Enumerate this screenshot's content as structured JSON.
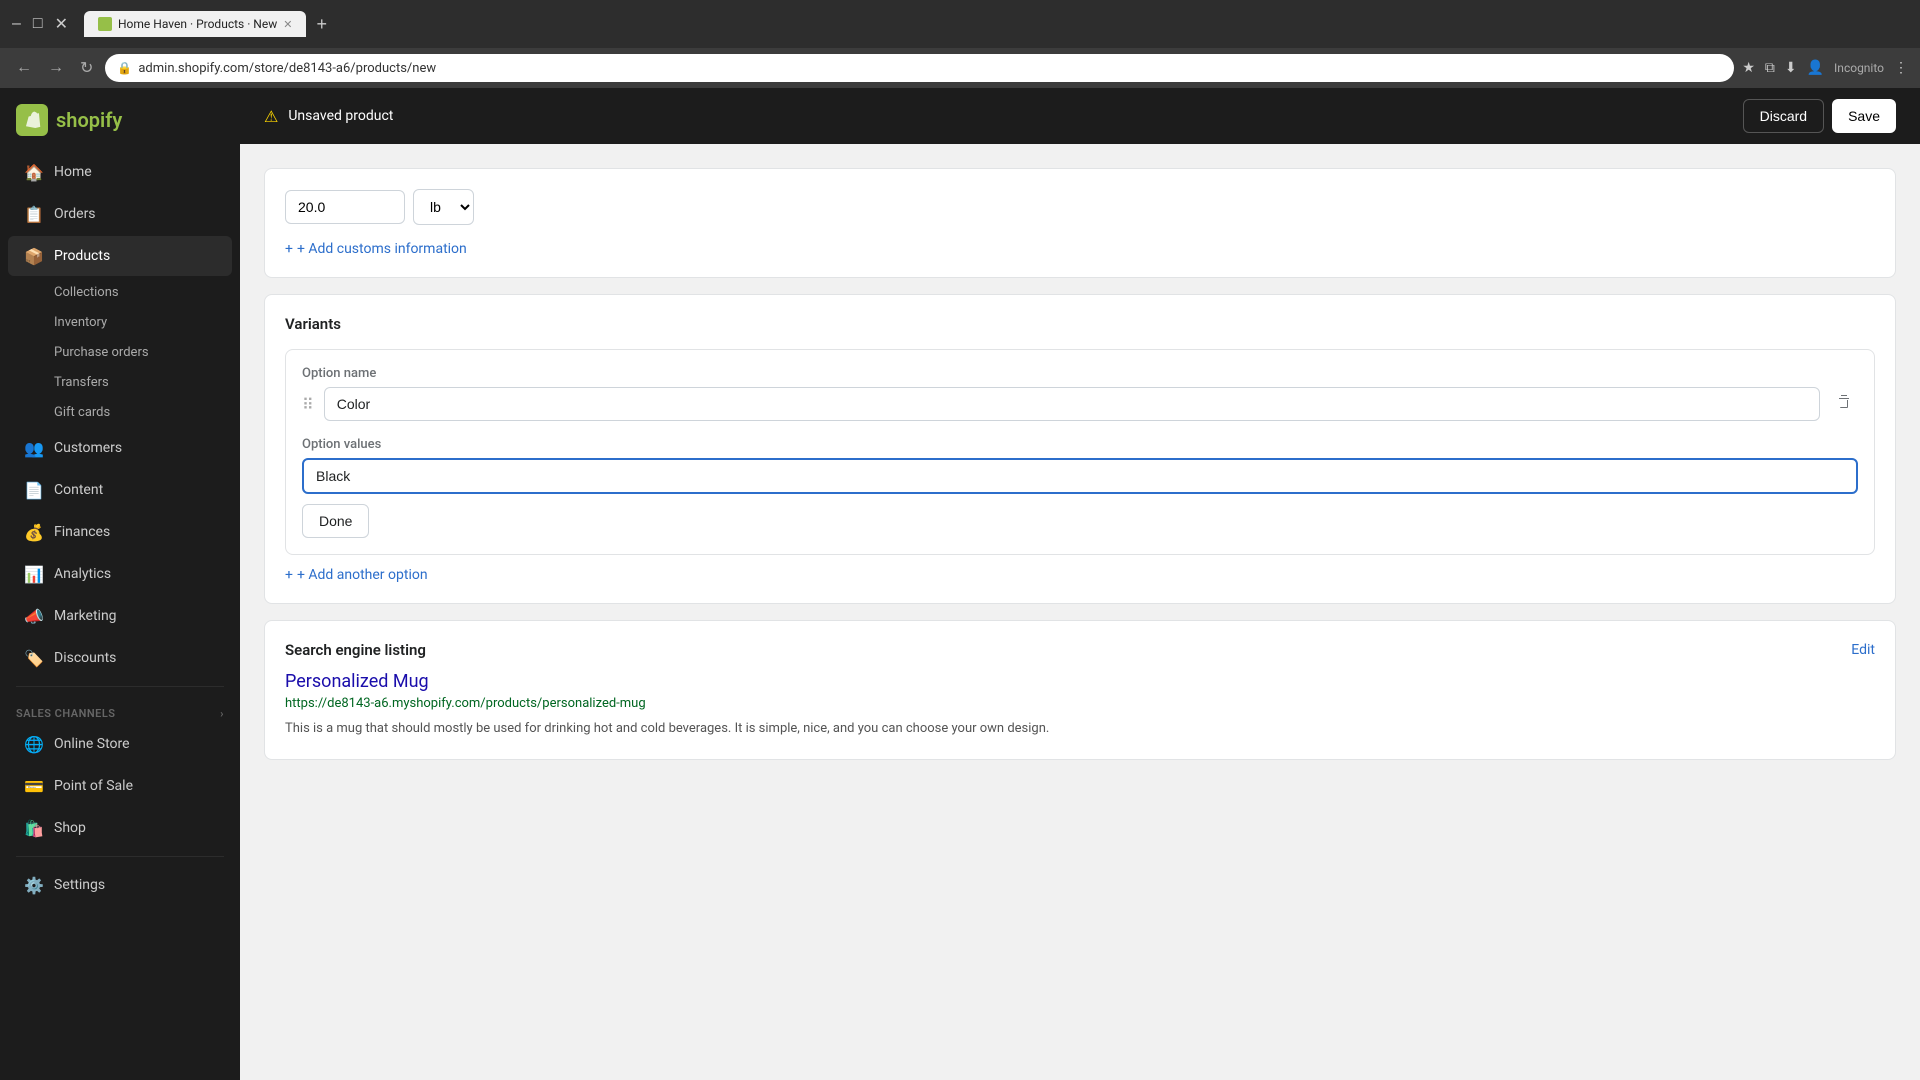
{
  "browser": {
    "tab_title": "Home Haven · Products · New",
    "tab_favicon": "S",
    "url": "admin.shopify.com/store/de8143-a6/products/new",
    "new_tab_label": "+",
    "nav_back": "←",
    "nav_forward": "→",
    "nav_refresh": "↻",
    "incognito_label": "Incognito"
  },
  "topbar": {
    "logo_text": "shopify",
    "unsaved_label": "Unsaved product",
    "discard_label": "Discard",
    "save_label": "Save"
  },
  "sidebar": {
    "logo": "S",
    "items": [
      {
        "id": "home",
        "label": "Home",
        "icon": "🏠"
      },
      {
        "id": "orders",
        "label": "Orders",
        "icon": "📋"
      },
      {
        "id": "products",
        "label": "Products",
        "icon": "📦",
        "active": true
      },
      {
        "id": "customers",
        "label": "Customers",
        "icon": "👥"
      },
      {
        "id": "content",
        "label": "Content",
        "icon": "📄"
      },
      {
        "id": "finances",
        "label": "Finances",
        "icon": "💰"
      },
      {
        "id": "analytics",
        "label": "Analytics",
        "icon": "📊"
      },
      {
        "id": "marketing",
        "label": "Marketing",
        "icon": "📣"
      },
      {
        "id": "discounts",
        "label": "Discounts",
        "icon": "🏷️"
      }
    ],
    "products_sub": [
      {
        "id": "collections",
        "label": "Collections"
      },
      {
        "id": "inventory",
        "label": "Inventory"
      },
      {
        "id": "purchase-orders",
        "label": "Purchase orders"
      },
      {
        "id": "transfers",
        "label": "Transfers"
      },
      {
        "id": "gift-cards",
        "label": "Gift cards"
      }
    ],
    "sales_channels_label": "Sales channels",
    "sales_channels_items": [
      {
        "id": "online-store",
        "label": "Online Store",
        "icon": "🌐"
      },
      {
        "id": "point-of-sale",
        "label": "Point of Sale",
        "icon": "💳"
      },
      {
        "id": "shop",
        "label": "Shop",
        "icon": "🛍️"
      }
    ],
    "settings_label": "Settings",
    "settings_icon": "⚙️"
  },
  "main": {
    "weight_value": "20.0",
    "weight_unit": "lb",
    "add_customs_label": "+ Add customs information",
    "variants_title": "Variants",
    "option_name_label": "Option name",
    "option_name_value": "Color",
    "option_values_label": "Option values",
    "option_values_placeholder": "Black",
    "done_label": "Done",
    "add_another_option_label": "+ Add another option",
    "seo_title": "Search engine listing",
    "seo_edit_label": "Edit",
    "seo_product_title": "Personalized Mug",
    "seo_url": "https://de8143-a6.myshopify.com/products/personalized-mug",
    "seo_description": "This is a mug that should mostly be used for drinking hot and cold beverages. It is simple, nice, and you can choose your own design."
  }
}
